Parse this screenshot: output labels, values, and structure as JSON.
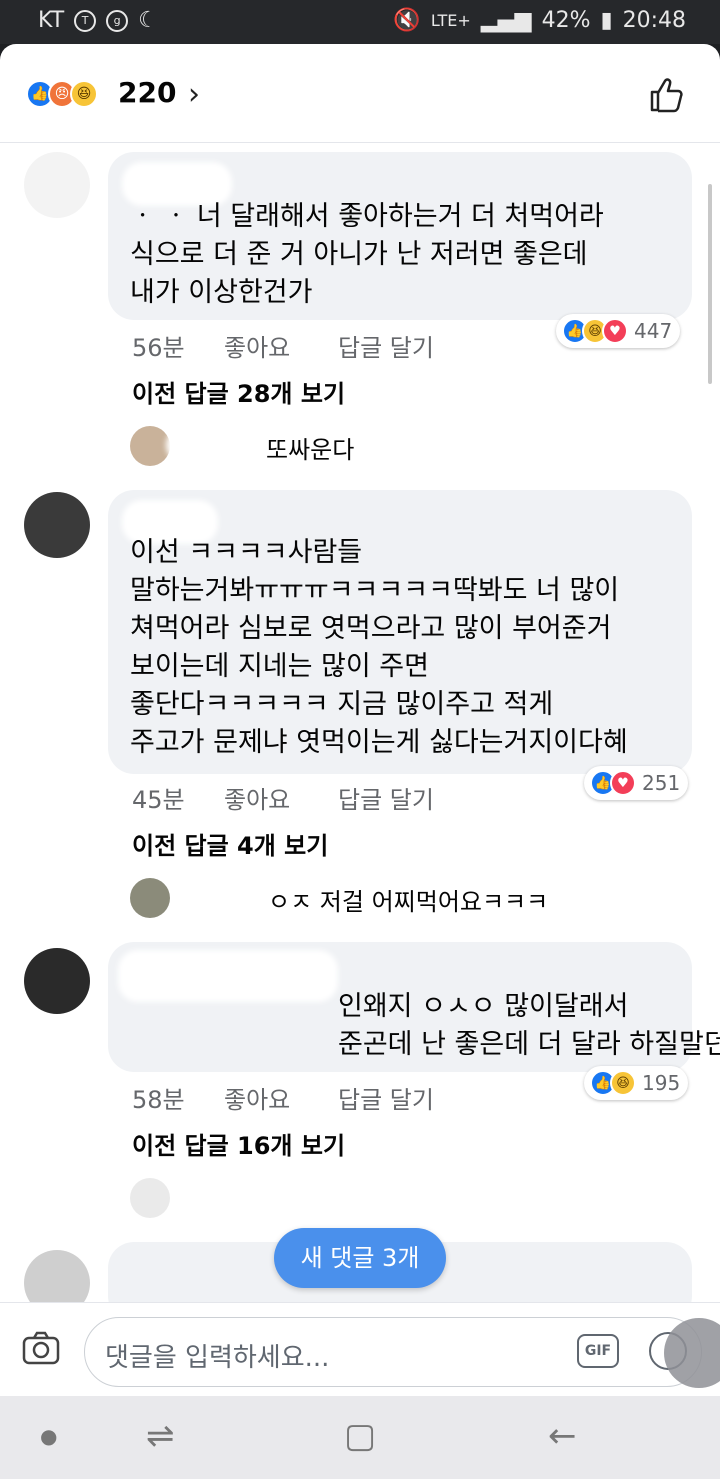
{
  "status_bar": {
    "carrier": "KT",
    "network": "LTE+",
    "battery": "42%",
    "time": "20:48"
  },
  "reactions": {
    "total": "220",
    "icons": [
      "like-icon",
      "angry-icon",
      "haha-icon"
    ]
  },
  "comments": [
    {
      "text": "ㆍ ㆍ 너 달래해서 좋아하는거 더 처먹어라\n식으로 더 준 거 아니가 난 저러면 좋은데\n내가 이상한건가",
      "time": "56분",
      "like": "좋아요",
      "reply": "답글 달기",
      "reaction_count": "447",
      "more_replies": "이전 답글 28개 보기",
      "latest_reply": "또싸운다"
    },
    {
      "text": "이선 ㅋㅋㅋㅋ사람들\n말하는거봐ㅠㅠㅠㅋㅋㅋㅋㅋ딱봐도 너 많이\n쳐먹어라 심보로 엿먹으라고 많이 부어준거\n보이는데 지네는 많이 주면\n좋단다ㅋㅋㅋㅋㅋ 지금 많이주고 적게\n주고가 문제냐 엿먹이는게 싫다는거지이다혜",
      "time": "45분",
      "like": "좋아요",
      "reply": "답글 달기",
      "reaction_count": "251",
      "more_replies": "이전 답글 4개 보기",
      "latest_reply": "ㅇㅈ 저걸 어찌먹어요ㅋㅋㅋ"
    },
    {
      "text": "인왜지 ㅇㅅㅇ 많이달래서\n준곤데 난 좋은데 더 달라 하질말던가 ㅎㅎ",
      "time": "58분",
      "like": "좋아요",
      "reply": "답글 달기",
      "reaction_count": "195",
      "more_replies": "이전 답글 16개 보기"
    }
  ],
  "new_comments_pill": "새 댓글 3개",
  "composer": {
    "placeholder": "댓글을 입력하세요...",
    "gif_label": "GIF"
  }
}
